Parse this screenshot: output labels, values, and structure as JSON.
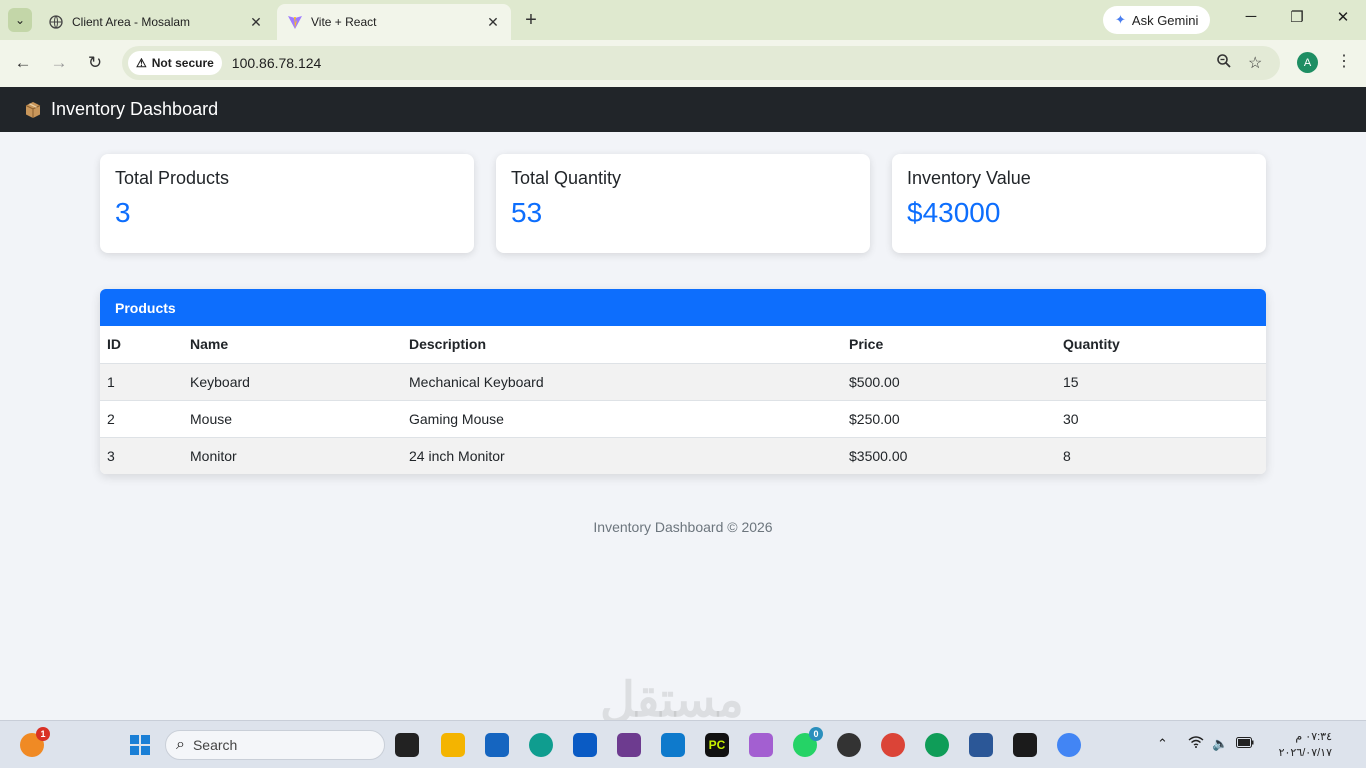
{
  "browser": {
    "tabs": [
      {
        "title": "Client Area - Mosalam",
        "active": false
      },
      {
        "title": "Vite + React",
        "active": true
      }
    ],
    "ask_gemini": "Ask Gemini",
    "security_label": "Not secure",
    "url": "100.86.78.124",
    "profile_initial": "A"
  },
  "app": {
    "title": "Inventory Dashboard",
    "cards": [
      {
        "label": "Total Products",
        "value": "3"
      },
      {
        "label": "Total Quantity",
        "value": "53"
      },
      {
        "label": "Inventory Value",
        "value": "$43000"
      }
    ],
    "products": {
      "heading": "Products",
      "columns": [
        "ID",
        "Name",
        "Description",
        "Price",
        "Quantity"
      ],
      "rows": [
        [
          "1",
          "Keyboard",
          "Mechanical Keyboard",
          "$500.00",
          "15"
        ],
        [
          "2",
          "Mouse",
          "Gaming Mouse",
          "$250.00",
          "30"
        ],
        [
          "3",
          "Monitor",
          "24 inch Monitor",
          "$3500.00",
          "8"
        ]
      ]
    },
    "footer": "Inventory Dashboard © 2026"
  },
  "taskbar": {
    "search_placeholder": "Search",
    "notification_count": "1",
    "whatsapp_badge": "0",
    "clock_time": "٠٧:٣٤ م",
    "clock_date": "٢٠٢٦/٠٧/١٧"
  },
  "watermark": "مستقل",
  "colors": {
    "navbar": "#212529",
    "accent": "#0d6efd",
    "page_bg": "#f2f4f8"
  }
}
